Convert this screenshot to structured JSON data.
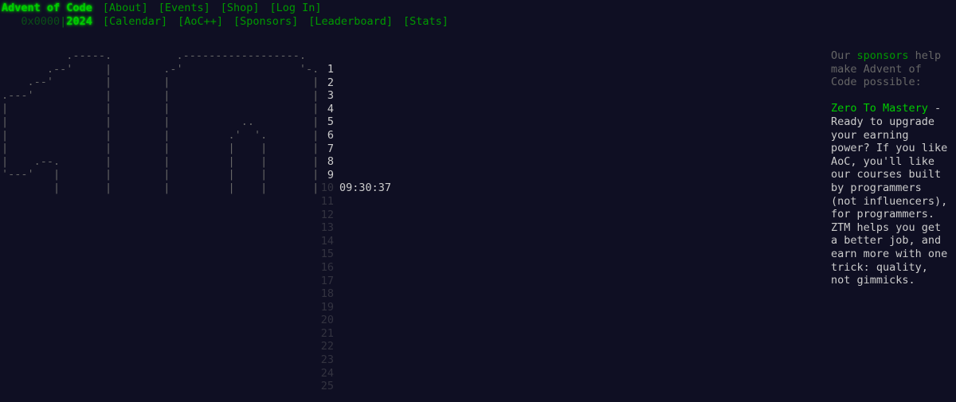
{
  "header": {
    "title": "Advent of Code",
    "nav": [
      "[About]",
      "[Events]",
      "[Shop]",
      "[Log In]"
    ],
    "year_prefix": "0x0000",
    "year_sep": "|",
    "year": "2024",
    "subnav": [
      "[Calendar]",
      "[AoC++]",
      "[Sponsors]",
      "[Leaderboard]",
      "[Stats]"
    ]
  },
  "calendar": {
    "art": "          .-----.          .------------------.\n       .--'     |        .-'                  '-.\n    .--'        |        |                      |\n.---'           |        |                      |\n|               |        |                      |\n|               |        |           ..         |\n|               |        |         .'  '.       |\n|               |        |         |    |       |\n|    .--.       |        |         |    |       |\n'---'   |       |        |         |    |       |\n        |       |        |         |    |       |",
    "days": [
      {
        "num": "1",
        "open": true
      },
      {
        "num": "2",
        "open": true
      },
      {
        "num": "3",
        "open": true
      },
      {
        "num": "4",
        "open": true
      },
      {
        "num": "5",
        "open": true
      },
      {
        "num": "6",
        "open": true
      },
      {
        "num": "7",
        "open": true
      },
      {
        "num": "8",
        "open": true
      },
      {
        "num": "9",
        "open": true
      },
      {
        "num": "10",
        "open": false,
        "timer": "09:30:37"
      },
      {
        "num": "11",
        "open": false
      },
      {
        "num": "12",
        "open": false
      },
      {
        "num": "13",
        "open": false
      },
      {
        "num": "14",
        "open": false
      },
      {
        "num": "15",
        "open": false
      },
      {
        "num": "16",
        "open": false
      },
      {
        "num": "17",
        "open": false
      },
      {
        "num": "18",
        "open": false
      },
      {
        "num": "19",
        "open": false
      },
      {
        "num": "20",
        "open": false
      },
      {
        "num": "21",
        "open": false
      },
      {
        "num": "22",
        "open": false
      },
      {
        "num": "23",
        "open": false
      },
      {
        "num": "24",
        "open": false
      },
      {
        "num": "25",
        "open": false
      }
    ]
  },
  "sidebar": {
    "intro_before": "Our ",
    "intro_link": "sponsors",
    "intro_after": " help make Advent of Code possible:",
    "sponsor_name": "Zero To Mastery",
    "sponsor_dash": " - ",
    "sponsor_text": "Ready to upgrade your earning power? If you like AoC, you'll like our courses built by programmers (not influencers), for programmers. ZTM helps you get a better job, and earn more with one trick: quality, not gimmicks."
  },
  "colors": {
    "background": "#0f0f23",
    "bright_green": "#00cc00",
    "link_green": "#009900",
    "text": "#cccccc",
    "dim": "#666666"
  }
}
